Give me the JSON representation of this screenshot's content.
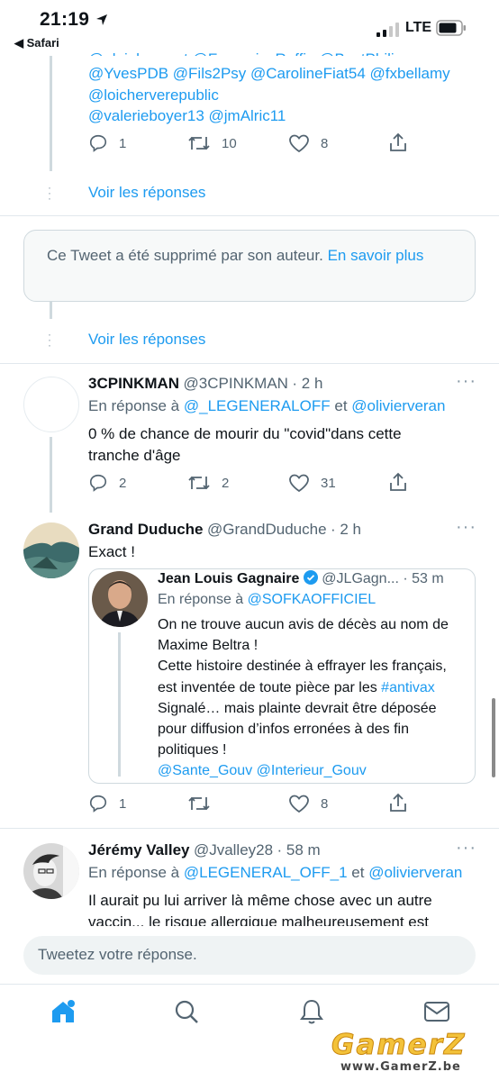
{
  "status_bar": {
    "time": "21:19",
    "back_label": "Safari",
    "network": "LTE"
  },
  "thread_top": {
    "mentions_partial": "@alainhoupert @Francois_Ruffin @BustPhilippe",
    "mentions": [
      "@YvesPDB @Fils2Psy @CarolineFiat54 @fxbellamy",
      "@loicherverepublic",
      "@valerieboyer13 @jmAlric11"
    ],
    "replies": "1",
    "retweets": "10",
    "likes": "8",
    "see_replies": "Voir les réponses"
  },
  "deleted": {
    "text": "Ce Tweet a été supprimé par son auteur.",
    "link": "En savoir plus",
    "see_replies": "Voir les réponses"
  },
  "tweet1": {
    "name": "3CPINKMAN",
    "handle": "@3CPINKMAN",
    "time": "· 2 h",
    "reply_prefix": "En réponse à",
    "reply_to_1": "@_LEGENERALOFF",
    "reply_and": "et",
    "reply_to_2": "@olivierveran",
    "text_1": "0 % de chance de mourir du \"covid\"dans cette",
    "text_2": "tranche d'âge",
    "replies": "2",
    "retweets": "2",
    "likes": "31"
  },
  "tweet2": {
    "name": "Grand Duduche",
    "handle": "@GrandDuduche",
    "time": "· 2 h",
    "text": "Exact !",
    "quote": {
      "name": "Jean Louis Gagnaire",
      "handle": "@JLGagn...",
      "time": "· 53 m",
      "reply_prefix": "En réponse à",
      "reply_to": "@SOFKAOFFICIEL",
      "lines": [
        "On ne trouve aucun avis de décès au nom de",
        "Maxime Beltra !",
        "Cette histoire destinée à effrayer les français,"
      ],
      "line4_prefix": "est inventée de toute pièce par les",
      "line4_tag": "#antivax",
      "lines_b": [
        "Signalé… mais plainte devrait être déposée",
        "pour diffusion d’infos erronées à des fin",
        "politiques !"
      ],
      "mentions": "@Sante_Gouv @Interieur_Gouv"
    },
    "replies": "1",
    "likes": "8"
  },
  "tweet3": {
    "name": "Jérémy Valley",
    "handle": "@Jvalley28",
    "time": "· 58 m",
    "reply_prefix": "En réponse à",
    "reply_to_1": "@LEGENERAL_OFF_1",
    "reply_and": "et",
    "reply_to_2": "@olivierveran",
    "text_1": "Il aurait pu lui arriver là même chose avec un autre",
    "text_2": "vaccin... le risque allergique malheureusement est"
  },
  "reply_input": {
    "placeholder": "Tweetez votre réponse."
  },
  "tabbar": {
    "items": [
      "home-icon",
      "search-icon",
      "notifications-icon",
      "messages-icon"
    ]
  },
  "watermark": {
    "logo": "GamerZ",
    "url": "www.GamerZ.be"
  },
  "colors": {
    "accent": "#1d9bf0",
    "text": "#0f1419",
    "muted": "#536471",
    "border": "#cfd9de"
  }
}
